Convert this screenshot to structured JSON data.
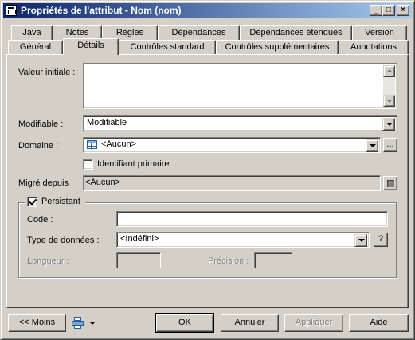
{
  "window": {
    "title": "Propriétés de l'attribut - Nom (nom)",
    "controls": {
      "minimize": "_",
      "maximize": "□",
      "close": "×"
    }
  },
  "tabs_row1": [
    "Java",
    "Notes",
    "Règles",
    "Dépendances",
    "Dépendances étendues",
    "Version"
  ],
  "tabs_row2": [
    "Général",
    "Détails",
    "Contrôles standard",
    "Contrôles supplémentaires",
    "Annotations"
  ],
  "active_tab": "Détails",
  "details": {
    "initial_value_label": "Valeur initiale :",
    "initial_value": "",
    "modifiable_label": "Modifiable :",
    "modifiable_value": "Modifiable",
    "domain_label": "Domaine :",
    "domain_value": "<Aucun>",
    "domain_browse": "...",
    "primary_id_label": "Identifiant primaire",
    "primary_id_checked": false,
    "migrated_label": "Migré depuis :",
    "migrated_value": "<Aucun>"
  },
  "persistent": {
    "label": "Persistant",
    "checked": true,
    "code_label": "Code :",
    "code_value": "",
    "datatype_label": "Type de données :",
    "datatype_value": "<Indéfini>",
    "datatype_help": "?",
    "length_label": "Longueur :",
    "length_value": "",
    "precision_label": "Précision :",
    "precision_value": ""
  },
  "footer": {
    "less_button": "<< Moins",
    "ok_button": "OK",
    "cancel_button": "Annuler",
    "apply_button": "Appliquer",
    "help_button": "Aide"
  },
  "colors": {
    "titlebar_start": "#0a246a",
    "titlebar_end": "#a6caf0",
    "face": "#d4d0c8"
  },
  "icons": [
    "window-app-icon",
    "domain-table-icon",
    "browse-object-icon",
    "print-icon",
    "chevron-down-icon"
  ]
}
